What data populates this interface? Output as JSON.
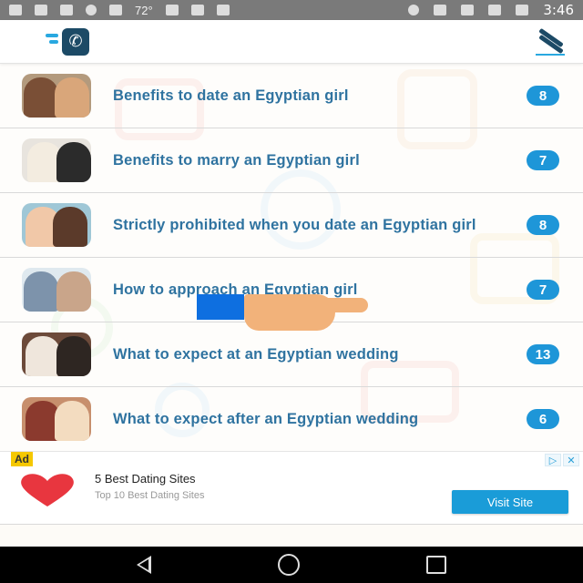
{
  "status_bar": {
    "temperature": "72°",
    "time": "3:46",
    "icons_left": [
      "facebook-icon",
      "email-icon",
      "keyboard-icon",
      "alarm-off-icon",
      "lock-icon",
      "temperature-icon",
      "photos-icon",
      "briefcase-icon",
      "calendar-icon"
    ],
    "icons_right": [
      "location-icon",
      "bluetooth-icon",
      "wifi-icon",
      "signal-icon",
      "battery-icon"
    ]
  },
  "app_bar": {
    "logo_icon": "phone-logo-icon",
    "action_icon": "edit-pencil-icon"
  },
  "list": {
    "items": [
      {
        "title": "Benefits to date an Egyptian girl",
        "count": "8"
      },
      {
        "title": "Benefits to marry an Egyptian girl",
        "count": "7"
      },
      {
        "title": "Strictly prohibited when you date an Egyptian girl",
        "count": "8"
      },
      {
        "title": "How to approach an Egyptian girl",
        "count": "7"
      },
      {
        "title": "What to expect at an Egyptian wedding",
        "count": "13"
      },
      {
        "title": "What to expect after an Egyptian wedding",
        "count": "6"
      }
    ]
  },
  "ad": {
    "label": "Ad",
    "title": "5 Best Dating Sites",
    "subtitle": "Top 10 Best Dating Sites",
    "button": "Visit Site",
    "choices_icon": "▷",
    "close_icon": "✕"
  },
  "nav_bar": {
    "back": "back-icon",
    "home": "home-icon",
    "recents": "recents-icon"
  },
  "colors": {
    "accent": "#1e96d8",
    "title_text": "#2f73a0",
    "brand_dark": "#1c4a66",
    "status_bar": "#7a7a7a"
  }
}
